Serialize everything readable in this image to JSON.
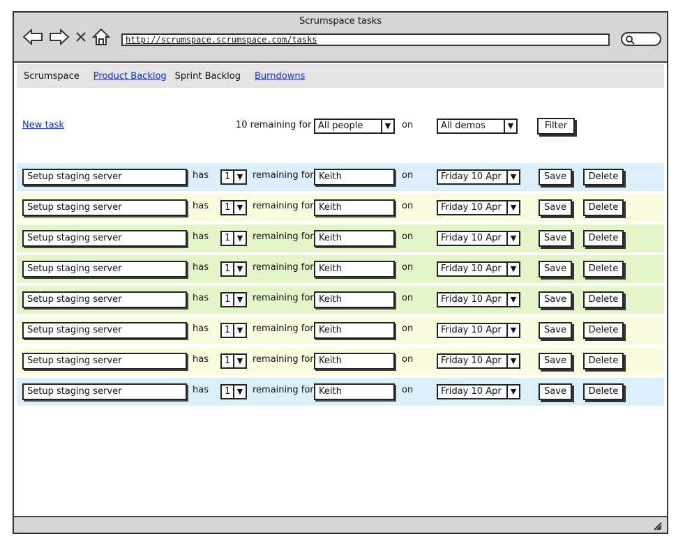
{
  "window": {
    "title": "Scrumspace tasks",
    "url": "http://scrumspace.scrumspace.com/tasks"
  },
  "menu": {
    "brand": "Scrumspace",
    "items": [
      {
        "label": "Product Backlog",
        "link": true
      },
      {
        "label": "Sprint Backlog",
        "link": false
      },
      {
        "label": "Burndowns",
        "link": true
      }
    ]
  },
  "filter": {
    "new_task": "New task",
    "remaining_text": "10 remaining for",
    "people_selected": "All people",
    "on": "on",
    "demos_selected": "All demos",
    "filter_button": "Filter"
  },
  "row_labels": {
    "has": "has",
    "remaining_for": "remaining for",
    "on": "on",
    "save": "Save",
    "delete": "Delete"
  },
  "colors": {
    "blue": "#dcf0fb",
    "yellow": "#fbfde0",
    "green": "#e4f6c9"
  },
  "tasks": [
    {
      "name": "Setup staging server",
      "remaining": "1",
      "person": "Keith",
      "date": "Friday 10 Apr",
      "color": "#dcf0fb"
    },
    {
      "name": "Setup staging server",
      "remaining": "1",
      "person": "Keith",
      "date": "Friday 10 Apr",
      "color": "#fbfde0"
    },
    {
      "name": "Setup staging server",
      "remaining": "1",
      "person": "Keith",
      "date": "Friday 10 Apr",
      "color": "#e4f6c9"
    },
    {
      "name": "Setup staging server",
      "remaining": "1",
      "person": "Keith",
      "date": "Friday 10 Apr",
      "color": "#e4f6c9"
    },
    {
      "name": "Setup staging server",
      "remaining": "1",
      "person": "Keith",
      "date": "Friday 10 Apr",
      "color": "#e4f6c9"
    },
    {
      "name": "Setup staging server",
      "remaining": "1",
      "person": "Keith",
      "date": "Friday 10 Apr",
      "color": "#fbfde0"
    },
    {
      "name": "Setup staging server",
      "remaining": "1",
      "person": "Keith",
      "date": "Friday 10 Apr",
      "color": "#fbfde0"
    },
    {
      "name": "Setup staging server",
      "remaining": "1",
      "person": "Keith",
      "date": "Friday 10 Apr",
      "color": "#dcf0fb"
    }
  ]
}
